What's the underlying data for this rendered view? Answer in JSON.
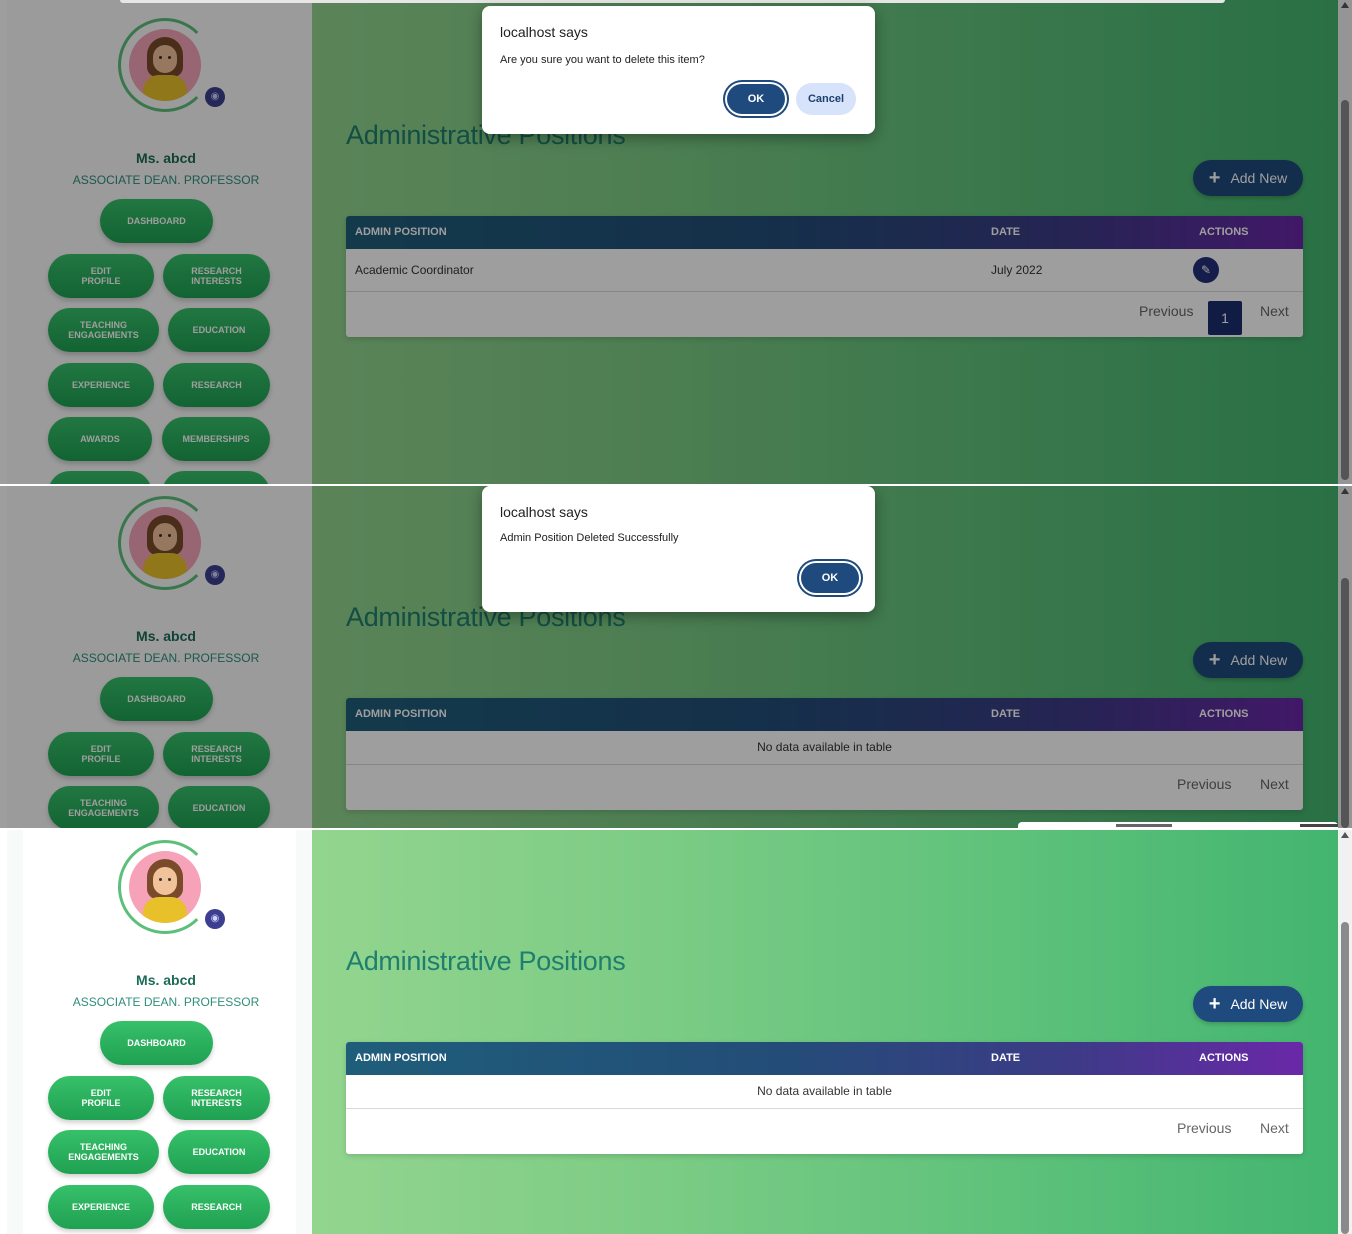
{
  "profile": {
    "name": "Ms. abcd",
    "role": "ASSOCIATE DEAN. PROFESSOR",
    "camera_icon": "camera-icon",
    "avatar_icon": "avatar-woman-icon"
  },
  "nav": {
    "dashboard": "DASHBOARD",
    "edit_profile_1": "EDIT",
    "edit_profile_2": "PROFILE",
    "research_interests_1": "RESEARCH",
    "research_interests_2": "INTERESTS",
    "teaching_1": "TEACHING",
    "teaching_2": "ENGAGEMENTS",
    "education": "EDUCATION",
    "experience": "EXPERIENCE",
    "research": "RESEARCH",
    "awards": "AWARDS",
    "memberships": "MEMBERSHIPS"
  },
  "page": {
    "title": "Administrative Positions",
    "add_new": "Add New",
    "add_icon": "plus-icon"
  },
  "table": {
    "headers": [
      "ADMIN POSITION",
      "DATE",
      "ACTIONS"
    ],
    "rows": [
      {
        "position": "Academic Coordinator",
        "date": "July 2022",
        "action_icon": "edit-icon"
      }
    ],
    "empty_text": "No data available in table",
    "previous": "Previous",
    "next": "Next",
    "current_page": "1"
  },
  "dialogs": {
    "confirm": {
      "title": "localhost says",
      "message": "Are you sure you want to delete this item?",
      "ok": "OK",
      "cancel": "Cancel"
    },
    "alert": {
      "title": "localhost says",
      "message": "Admin Position Deleted Successfully",
      "ok": "OK"
    }
  },
  "colors": {
    "accent": "#1f4a7d",
    "title": "#1e7f6e",
    "nav_button": "#2bb35e"
  }
}
